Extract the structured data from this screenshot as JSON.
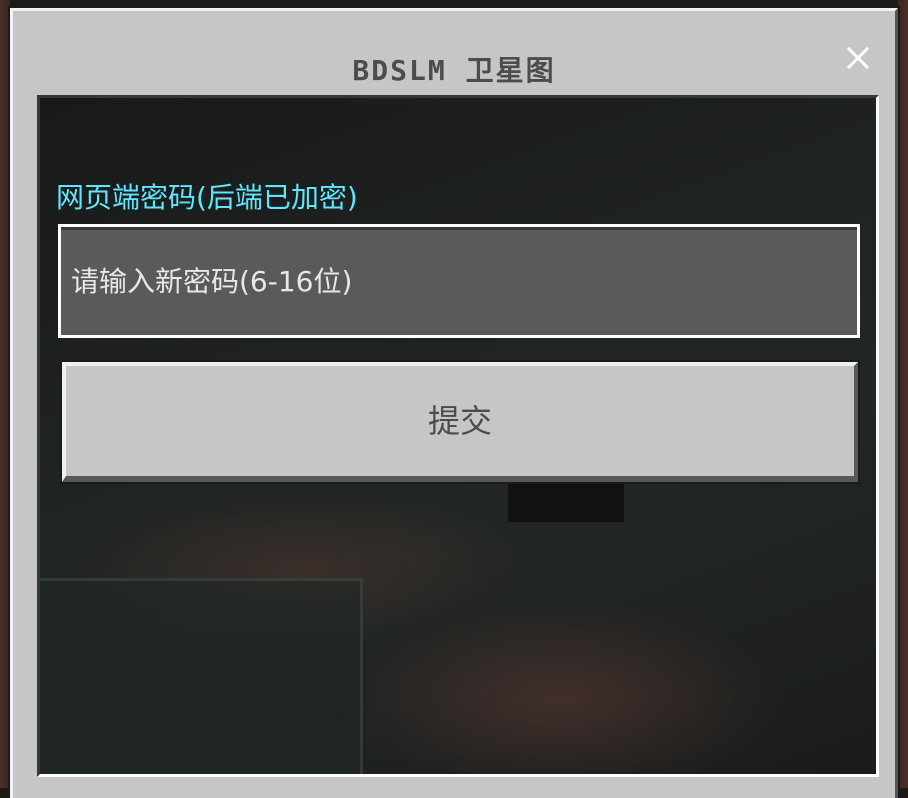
{
  "dialog": {
    "title": "BDSLM 卫星图",
    "close_icon": "close-icon"
  },
  "form": {
    "password_label": "网页端密码(后端已加密)",
    "password_placeholder": "请输入新密码(6-16位)",
    "password_value": "",
    "submit_label": "提交"
  },
  "colors": {
    "dialog_bg": "#c6c6c6",
    "label": "#5fe7ff",
    "field_bg": "#5a5a5a",
    "title_text": "#4c4c4c"
  }
}
